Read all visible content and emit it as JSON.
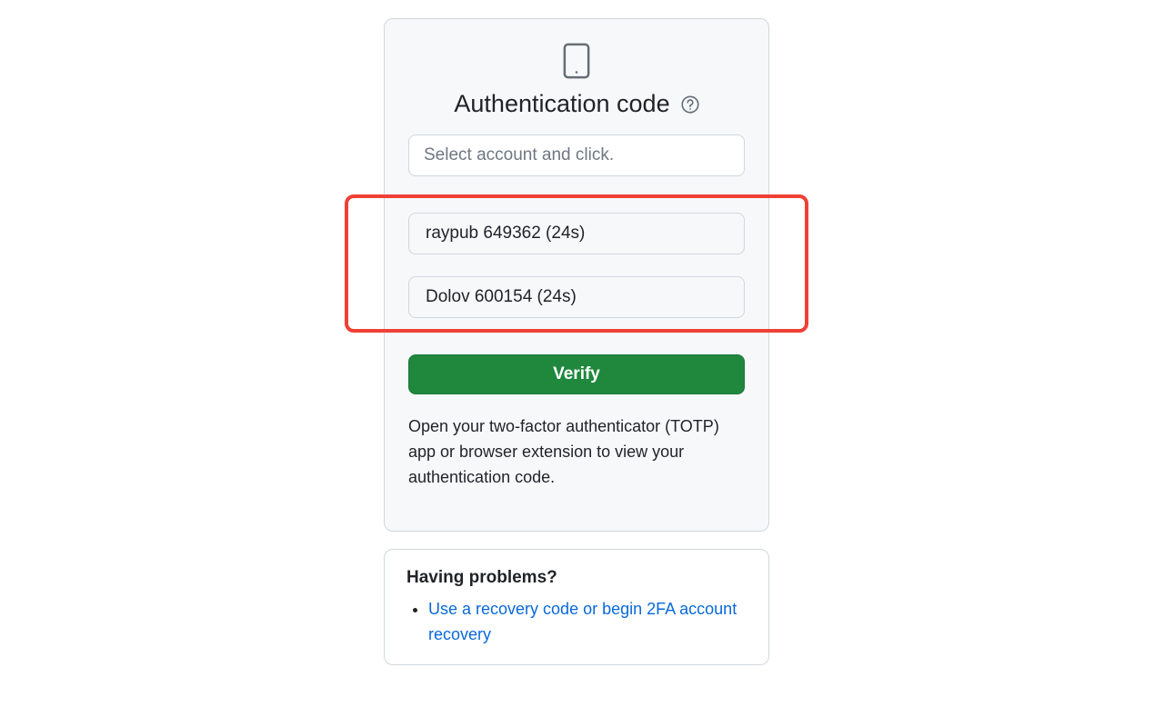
{
  "auth": {
    "title": "Authentication code",
    "input_placeholder": "Select account and click.",
    "accounts": [
      "raypub 649362 (24s)",
      "Dolov 600154 (24s)"
    ],
    "verify_label": "Verify",
    "hint": "Open your two-factor authenticator (TOTP) app or browser extension to view your authentication code."
  },
  "problems": {
    "heading": "Having problems?",
    "link_text": "Use a recovery code or begin 2FA account recovery"
  }
}
